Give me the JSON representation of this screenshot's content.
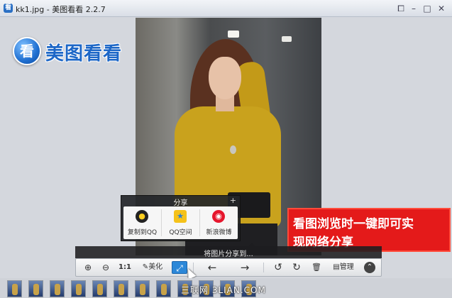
{
  "window": {
    "title": "kk1.jpg - 美图看看 2.2.7",
    "app_icon_glyph": "看",
    "controls": {
      "restore": "⧠",
      "minimize": "–",
      "maximize": "□",
      "close": "✕"
    }
  },
  "logo": {
    "glyph": "看",
    "text": "美图看看"
  },
  "share_panel": {
    "title": "分享",
    "add_symbol": "+",
    "items": [
      {
        "label": "复制到QQ",
        "icon": "qq-penguin-icon"
      },
      {
        "label": "QQ空间",
        "icon": "qzone-star-icon"
      },
      {
        "label": "新浪微博",
        "icon": "weibo-icon"
      }
    ]
  },
  "share_strip": {
    "text": "将图片分享到..."
  },
  "promo": {
    "line1": "看图浏览时一键即可实",
    "line2": "现网络分享"
  },
  "toolbar": {
    "zoom_in": "⊕",
    "zoom_out": "⊖",
    "actual_size": "1:1",
    "beautify": "美化",
    "share": "⤢",
    "prev": "←",
    "next": "→",
    "rotate_left": "↺",
    "rotate_right": "↻",
    "delete": "🗑",
    "manage": "管理",
    "more": "⌃"
  },
  "watermark": "三联网 3LIAN.COM",
  "colors": {
    "accent": "#2b87d8",
    "promo_red": "#e41a1a",
    "logo_blue": "#1d67c7"
  }
}
